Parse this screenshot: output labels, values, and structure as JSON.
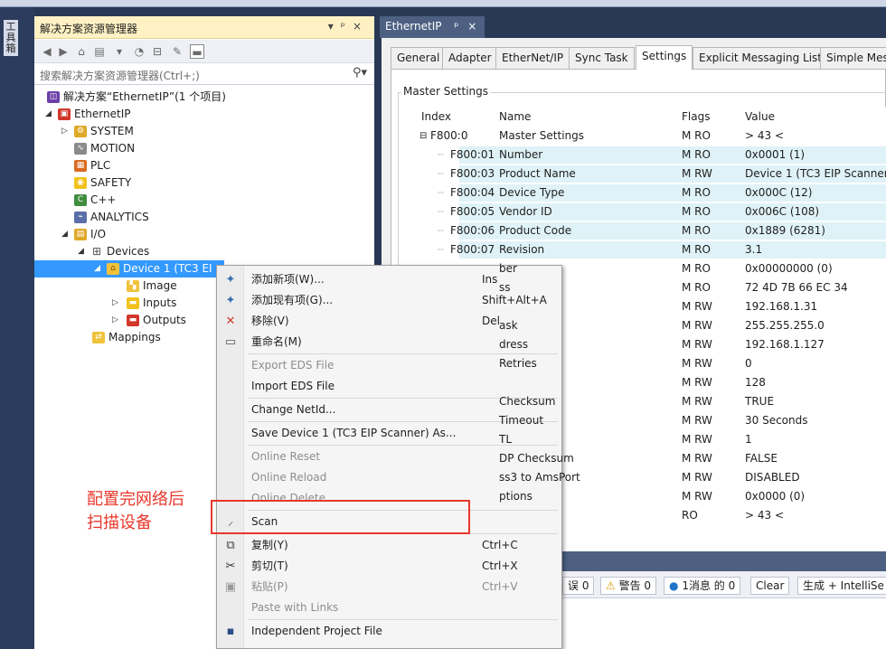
{
  "solution_explorer": {
    "title": "解决方案资源管理器",
    "title_buttons": [
      "▾",
      "ᵖ",
      "×"
    ],
    "search_placeholder": "搜索解决方案资源管理器(Ctrl+;)",
    "tree": [
      {
        "label": "解决方案“EthernetIP”(1 个项目)",
        "icon": "solution-icon"
      },
      {
        "label": "EthernetIP",
        "icon": "project-icon"
      },
      {
        "label": "SYSTEM",
        "icon": "system-icon"
      },
      {
        "label": "MOTION",
        "icon": "motion-icon"
      },
      {
        "label": "PLC",
        "icon": "plc-icon"
      },
      {
        "label": "SAFETY",
        "icon": "safety-icon"
      },
      {
        "label": "C++",
        "icon": "cpp-icon"
      },
      {
        "label": "ANALYTICS",
        "icon": "analytics-icon"
      },
      {
        "label": "I/O",
        "icon": "io-icon"
      },
      {
        "label": "Devices",
        "icon": "devices-icon"
      },
      {
        "label": "Device 1 (TC3 EI",
        "icon": "device-icon"
      },
      {
        "label": "Image",
        "icon": "image-icon"
      },
      {
        "label": "Inputs",
        "icon": "inputs-icon"
      },
      {
        "label": "Outputs",
        "icon": "outputs-icon"
      },
      {
        "label": "Mappings",
        "icon": "mappings-icon"
      }
    ]
  },
  "toolbox_tab": "工具箱",
  "document": {
    "tab_title": "EthernetIP",
    "tab_pin": "ᵖ",
    "tab_close": "×",
    "tabs": [
      "General",
      "Adapter",
      "EtherNet/IP",
      "Sync Task",
      "Settings",
      "Explicit Messaging List",
      "Simple Mes"
    ],
    "selected_tab": "Settings",
    "group_title": "Master Settings",
    "columns": [
      "Index",
      "Name",
      "Flags",
      "Value"
    ],
    "rows": [
      {
        "index": "F800:0",
        "name": "Master Settings",
        "flags": "M RO",
        "value": "> 43 <",
        "expander": "⊟"
      },
      {
        "index": "F800:01",
        "name": "Number",
        "flags": "M RO",
        "value": "0x0001 (1)"
      },
      {
        "index": "F800:03",
        "name": "Product Name",
        "flags": "M RW",
        "value": "Device 1 (TC3 EIP Scanner"
      },
      {
        "index": "F800:04",
        "name": "Device Type",
        "flags": "M RO",
        "value": "0x000C (12)"
      },
      {
        "index": "F800:05",
        "name": "Vendor ID",
        "flags": "M RO",
        "value": "0x006C (108)"
      },
      {
        "index": "F800:06",
        "name": "Product Code",
        "flags": "M RO",
        "value": "0x1889 (6281)"
      },
      {
        "index": "F800:07",
        "name": "Revision",
        "flags": "M RO",
        "value": "3.1"
      },
      {
        "index": "",
        "name": "ber",
        "flags": "M RO",
        "value": "0x00000000 (0)"
      },
      {
        "index": "",
        "name": "ss",
        "flags": "M RO",
        "value": "72 4D 7B 66 EC 34"
      },
      {
        "index": "",
        "name": "",
        "flags": "M RW",
        "value": "192.168.1.31"
      },
      {
        "index": "",
        "name": "ask",
        "flags": "M RW",
        "value": "255.255.255.0"
      },
      {
        "index": "",
        "name": "dress",
        "flags": "M RW",
        "value": "192.168.1.127"
      },
      {
        "index": "",
        "name": "Retries",
        "flags": "M RW",
        "value": "0"
      },
      {
        "index": "",
        "name": "",
        "flags": "M RW",
        "value": "128"
      },
      {
        "index": "",
        "name": "Checksum",
        "flags": "M RW",
        "value": "TRUE"
      },
      {
        "index": "",
        "name": "Timeout",
        "flags": "M RW",
        "value": "30 Seconds"
      },
      {
        "index": "",
        "name": "TL",
        "flags": "M RW",
        "value": "1"
      },
      {
        "index": "",
        "name": "DP Checksum",
        "flags": "M RW",
        "value": "FALSE"
      },
      {
        "index": "",
        "name": "ss3 to AmsPort",
        "flags": "M RW",
        "value": "DISABLED"
      },
      {
        "index": "",
        "name": "ptions",
        "flags": "M RW",
        "value": "0x0000 (0)"
      },
      {
        "index": "",
        "name": "",
        "flags": "RO",
        "value": "> 43 <"
      }
    ]
  },
  "output_toolbar": {
    "errors": "误 0",
    "warnings": "警告 0",
    "messages": "1消息 的 0",
    "clear": "Clear",
    "build": "生成 + IntelliSe"
  },
  "context_menu": {
    "items": [
      {
        "label": "添加新项(W)...",
        "shortcut": "Ins",
        "icon": "add-new-item-icon",
        "disabled": false
      },
      {
        "label": "添加现有项(G)...",
        "shortcut": "Shift+Alt+A",
        "icon": "add-existing-item-icon",
        "disabled": false
      },
      {
        "label": "移除(V)",
        "shortcut": "Del",
        "icon": "remove-icon",
        "disabled": false
      },
      {
        "label": "重命名(M)",
        "shortcut": "",
        "icon": "rename-icon",
        "disabled": false
      },
      {
        "label": "Export EDS File",
        "shortcut": "",
        "icon": "",
        "disabled": true
      },
      {
        "label": "Import EDS File",
        "shortcut": "",
        "icon": "",
        "disabled": false
      },
      {
        "label": "Change NetId...",
        "shortcut": "",
        "icon": "",
        "disabled": false
      },
      {
        "label": "Save Device 1 (TC3 EIP Scanner) As...",
        "shortcut": "",
        "icon": "",
        "disabled": false
      },
      {
        "label": "Online Reset",
        "shortcut": "",
        "icon": "",
        "disabled": true
      },
      {
        "label": "Online Reload",
        "shortcut": "",
        "icon": "",
        "disabled": true
      },
      {
        "label": "Online Delete",
        "shortcut": "",
        "icon": "",
        "disabled": true
      },
      {
        "label": "Scan",
        "shortcut": "",
        "icon": "scan-wand-icon",
        "disabled": false
      },
      {
        "label": "复制(Y)",
        "shortcut": "Ctrl+C",
        "icon": "copy-icon",
        "disabled": false
      },
      {
        "label": "剪切(T)",
        "shortcut": "Ctrl+X",
        "icon": "cut-icon",
        "disabled": false
      },
      {
        "label": "粘贴(P)",
        "shortcut": "Ctrl+V",
        "icon": "paste-icon",
        "disabled": true
      },
      {
        "label": "Paste with Links",
        "shortcut": "",
        "icon": "",
        "disabled": true
      },
      {
        "label": "Independent Project File",
        "shortcut": "",
        "icon": "save-icon",
        "disabled": false
      }
    ]
  },
  "annotation": {
    "text_line1": "配置完网络后",
    "text_line2": "扫描设备",
    "color": "#e8372a"
  },
  "colors": {
    "ide_background": "#293955",
    "explorer_title": "#fff1c4",
    "selected_row": "#3399ff",
    "highlight_row": "#dff2f7"
  }
}
